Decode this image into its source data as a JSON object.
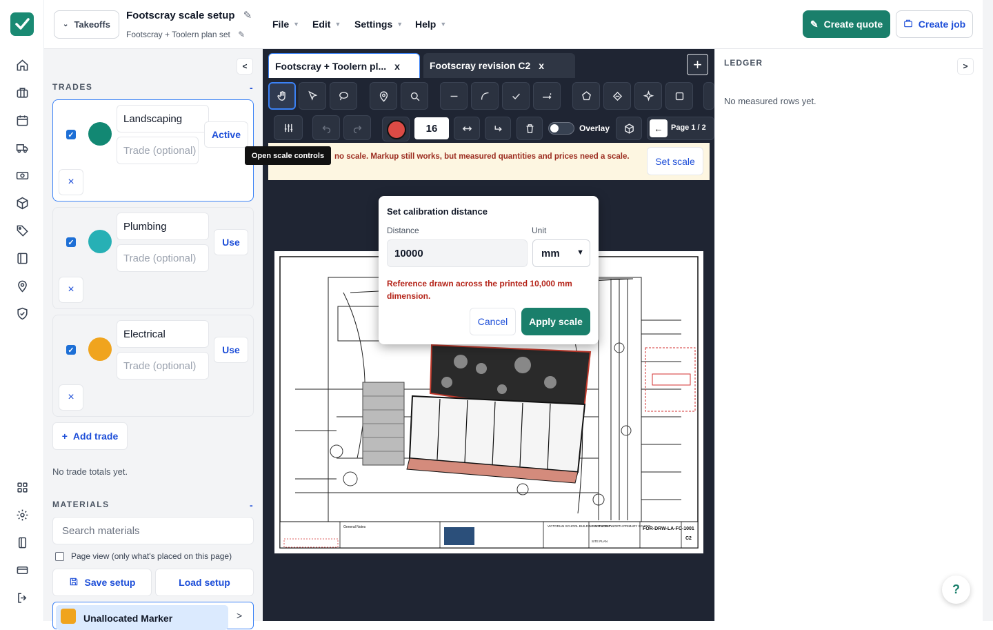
{
  "header": {
    "takeoffs_label": "Takeoffs",
    "project_title": "Footscray scale setup",
    "project_subtitle": "Footscray + Toolern plan set",
    "menu": [
      "File",
      "Edit",
      "Settings",
      "Help"
    ],
    "create_quote": "Create quote",
    "create_job": "Create job"
  },
  "colors": {
    "brand": "#1a7f6b",
    "accent": "#1d4ed8",
    "warning_text": "#9b2b1f"
  },
  "rail": {
    "icons": [
      "home-icon",
      "briefcase-icon",
      "calendar-icon",
      "truck-icon",
      "cash-icon",
      "box-icon",
      "tag-icon",
      "book-icon",
      "map-pin-icon",
      "shield-check-icon",
      "grid-icon",
      "gear-icon",
      "book-open-icon",
      "credit-card-icon",
      "logout-icon"
    ]
  },
  "left": {
    "collapse_label": "<",
    "trades_title": "TRADES",
    "trades_toggle": "-",
    "trades": [
      {
        "name": "Landscaping",
        "trade_placeholder": "Trade (optional)",
        "action": "Active",
        "color": "#128873",
        "checked": true
      },
      {
        "name": "Plumbing",
        "trade_placeholder": "Trade (optional)",
        "action": "Use",
        "color": "#27b0b5",
        "checked": true
      },
      {
        "name": "Electrical",
        "trade_placeholder": "Trade (optional)",
        "action": "Use",
        "color": "#f0a41e",
        "checked": true
      }
    ],
    "remove_label": "×",
    "add_trade": "Add trade",
    "no_totals": "No trade totals yet.",
    "materials_title": "MATERIALS",
    "materials_toggle": "-",
    "search_placeholder": "Search materials",
    "page_view_label": "Page view (only what's placed on this page)",
    "save_setup": "Save setup",
    "load_setup": "Load setup",
    "unallocated_label": "Unallocated Marker",
    "unallocated_arrow": ">"
  },
  "center": {
    "tabs": [
      {
        "label": "Footscray + Toolern pl...",
        "close": "x"
      },
      {
        "label": "Footscray revision C2",
        "close": "x"
      }
    ],
    "add_tab": "+",
    "line_size": "16",
    "overlay_label": "Overlay",
    "page_label": "Page 1 / 2",
    "warning": "no scale. Markup still works, but measured quantities and prices need a scale.",
    "set_scale": "Set scale",
    "tooltip": "Open scale controls",
    "plan_labels": {
      "drawing_no": "FOR-DRW-LA-FC-1001",
      "revision": "C2",
      "client": "VICTORIAN SCHOOL BUILDING AUTHORITY",
      "project": "FOOTSCRAY NORTH PRIMARY SCHOOL",
      "sheet": "SITE PLAN",
      "notes_title": "General Notes"
    }
  },
  "popup": {
    "title": "Set calibration distance",
    "distance_label": "Distance",
    "distance_value": "10000",
    "unit_label": "Unit",
    "unit_value": "mm",
    "error": "Reference drawn across the printed 10,000 mm dimension.",
    "cancel": "Cancel",
    "apply": "Apply scale"
  },
  "right": {
    "title": "LEDGER",
    "toggle": ">",
    "empty": "No measured rows yet."
  },
  "help": "?"
}
